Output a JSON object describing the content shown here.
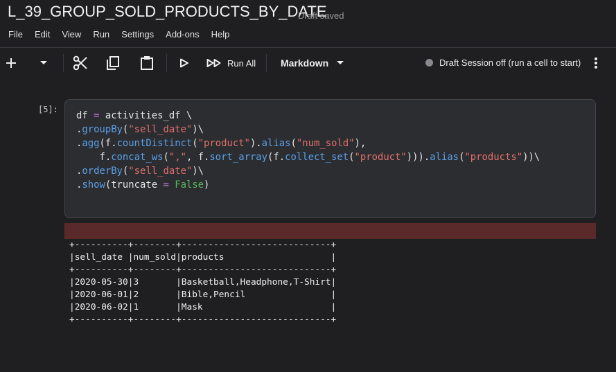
{
  "header": {
    "title": "L_39_GROUP_SOLD_PRODUCTS_BY_DATE",
    "save_status": "Draft saved"
  },
  "menu": [
    "File",
    "Edit",
    "View",
    "Run",
    "Settings",
    "Add-ons",
    "Help"
  ],
  "toolbar": {
    "run_all_label": "Run All",
    "cell_type": "Markdown",
    "session_status": "Draft Session off (run a cell to start)"
  },
  "cell": {
    "prompt": "[5]:",
    "code_lines": [
      "df = activities_df \\",
      ".groupBy(\"sell_date\")\\",
      ".agg(f.countDistinct(\"product\").alias(\"num_sold\"),",
      "    f.concat_ws(\",\", f.sort_array(f.collect_set(\"product\"))).alias(\"products\"))\\",
      ".orderBy(\"sell_date\")\\",
      ".show(truncate = False)"
    ]
  },
  "output": {
    "columns": [
      "sell_date",
      "num_sold",
      "products"
    ],
    "rows": [
      [
        "2020-05-30",
        "3",
        "Basketball,Headphone,T-Shirt"
      ],
      [
        "2020-06-01",
        "2",
        "Bible,Pencil"
      ],
      [
        "2020-06-02",
        "1",
        "Mask"
      ]
    ],
    "text": "+----------+--------+----------------------------+\n|sell_date |num_sold|products                    |\n+----------+--------+----------------------------+\n|2020-05-30|3       |Basketball,Headphone,T-Shirt|\n|2020-06-01|2       |Bible,Pencil                |\n|2020-06-02|1       |Mask                        |\n+----------+--------+----------------------------+"
  }
}
